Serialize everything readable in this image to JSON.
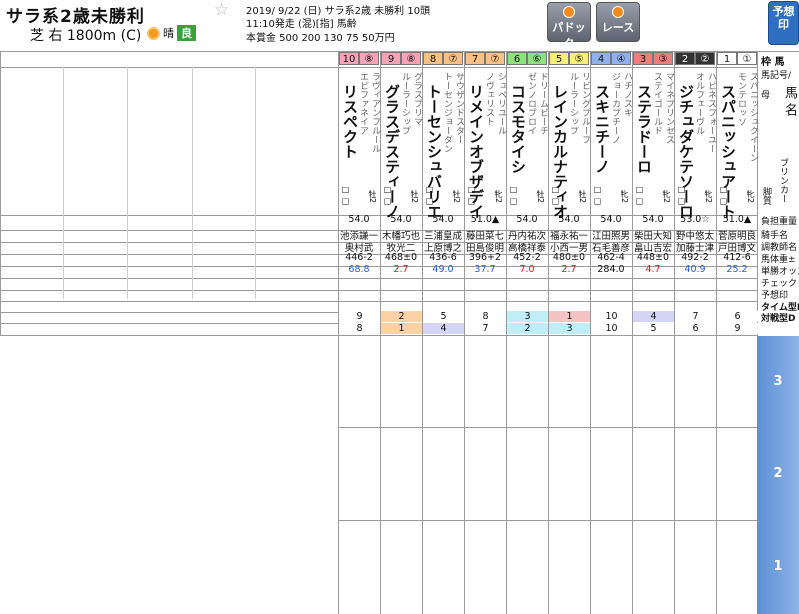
{
  "header": {
    "race_name": "サラ系2歳未勝利",
    "course": "芝 右 1800m (C)",
    "weather": "晴",
    "going": "良",
    "info_line1": "2019/ 9/22 (日)  サラ系2歳  未勝利  10頭",
    "info_line2": "11:10発走 (混)[指]  馬齢",
    "info_line3": "本賞金 500 200 130 75 50万円",
    "paddock_label": "パドック",
    "race_label": "レース",
    "yosou_label": "予想印"
  },
  "right_labels": {
    "col_head": "枠 馬",
    "mark": "馬記号/",
    "mother": "母",
    "horse_name": "馬 名",
    "blinker": "ブリンカー",
    "burden": "脚質",
    "rows": [
      "負担重量",
      "騎手名",
      "調教師名",
      "馬体重±",
      "単勝オッズ",
      "チェック",
      "予想印",
      "タイム型D",
      "対戦型D"
    ]
  },
  "horses": [
    {
      "no": "10",
      "waku": "⑧",
      "name": "リスペクト",
      "sire": "ラヴィアンフルール",
      "mother": "エピファネイア",
      "sex": "牡2",
      "weight": "54.0",
      "jockey": "池添謙一",
      "trainer": "奥村武",
      "body": "446-2",
      "odds": "68.8",
      "odds_color": "blue",
      "time": "9",
      "vs": "8"
    },
    {
      "no": "9",
      "waku": "⑧",
      "name": "グラスデスティーノ",
      "sire": "グラスブリマ",
      "mother": "ルーラーシップ",
      "sex": "牡2",
      "weight": "54.0",
      "jockey": "木幡巧也",
      "trainer": "牧光二",
      "body": "468±0",
      "odds": "2.7",
      "odds_color": "red",
      "time": "2",
      "vs": "1"
    },
    {
      "no": "8",
      "waku": "⑦",
      "name": "トーセンシュバリエ",
      "sire": "サウザンドスター",
      "mother": "トーセンジョーダン",
      "sex": "牡2",
      "weight": "54.0",
      "jockey": "三浦皇成",
      "trainer": "上原博之",
      "body": "436-6",
      "odds": "49.0",
      "odds_color": "blue",
      "time": "5",
      "vs": "4"
    },
    {
      "no": "7",
      "waku": "⑦",
      "name": "リメインオブザデイ",
      "sire": "シュペリユール",
      "mother": "ノヴェリスト",
      "sex": "牝2",
      "weight": "51.0▲",
      "jockey": "藤田菜七",
      "trainer": "田島俊明",
      "body": "396+2",
      "odds": "37.7",
      "odds_color": "blue",
      "time": "8",
      "vs": "7"
    },
    {
      "no": "6",
      "waku": "⑥",
      "name": "コスモタイシ",
      "sire": "ドリームビーチ",
      "mother": "ゼンノロブロイ",
      "sex": "牡2",
      "weight": "54.0",
      "jockey": "丹内祐次",
      "trainer": "高橋祥泰",
      "body": "452-2",
      "odds": "7.0",
      "odds_color": "red",
      "time": "3",
      "vs": "2"
    },
    {
      "no": "5",
      "waku": "⑤",
      "name": "レインカルナティオ",
      "sire": "リビングプルーフ",
      "mother": "ルーラーシップ",
      "sex": "牡2",
      "weight": "54.0",
      "jockey": "福永祐一",
      "trainer": "小西一男",
      "body": "480±0",
      "odds": "2.7",
      "odds_color": "red",
      "time": "1",
      "vs": "3"
    },
    {
      "no": "4",
      "waku": "④",
      "name": "スキニチーノ",
      "sire": "ハチノスキ",
      "mother": "ジョーカプチーノ",
      "sex": "牝2",
      "weight": "54.0",
      "jockey": "江田照男",
      "trainer": "石毛善彦",
      "body": "462-4",
      "odds": "284.0",
      "odds_color": "black",
      "time": "10",
      "vs": "10"
    },
    {
      "no": "3",
      "waku": "③",
      "name": "ステラドーロ",
      "sire": "マイネプリンセス",
      "mother": "ステイゴールド",
      "sex": "牝2",
      "weight": "54.0",
      "jockey": "柴田大知",
      "trainer": "畠山吉宏",
      "body": "448±0",
      "odds": "4.7",
      "odds_color": "red",
      "time": "4",
      "vs": "5"
    },
    {
      "no": "2",
      "waku": "②",
      "name": "ジチュダケテソーロ",
      "sire": "ハピネスフォーユー",
      "mother": "オルフェーヴル",
      "sex": "牝2",
      "weight": "53.0☆",
      "jockey": "野中悠太",
      "trainer": "加藤士津",
      "body": "492-2",
      "odds": "40.9",
      "odds_color": "blue",
      "time": "7",
      "vs": "6"
    },
    {
      "no": "1",
      "waku": "①",
      "name": "スパニッシュアート",
      "sire": "スパニッシュクイーン",
      "mother": "モンテロッソ",
      "sex": "牝2",
      "weight": "51.0▲",
      "jockey": "菅原明良",
      "trainer": "戸田博文",
      "body": "412-6",
      "odds": "25.2",
      "odds_color": "blue",
      "time": "6",
      "vs": "9"
    }
  ],
  "past_sections": [
    "3",
    "2",
    "1"
  ]
}
